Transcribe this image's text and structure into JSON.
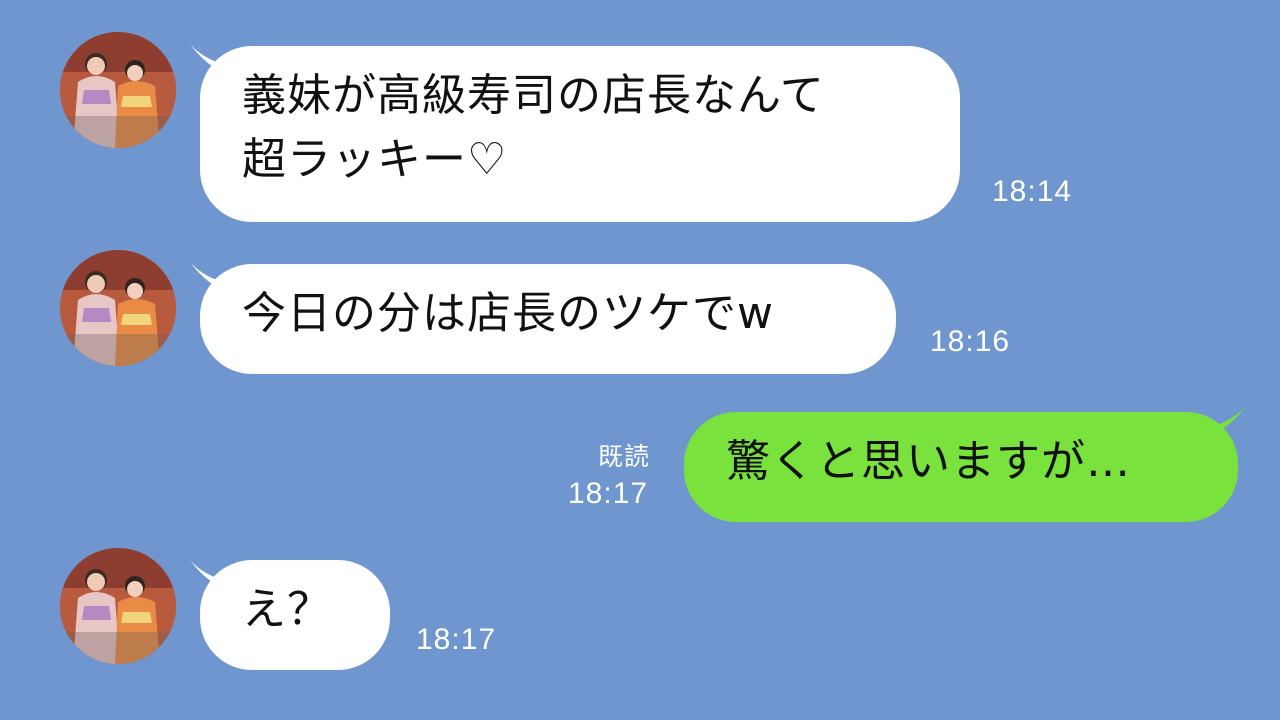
{
  "messages": [
    {
      "id": "m1",
      "direction": "incoming",
      "text": "義妹が高級寿司の店長なんて\n超ラッキー♡",
      "time": "18:14"
    },
    {
      "id": "m2",
      "direction": "incoming",
      "text": "今日の分は店長のツケでw",
      "time": "18:16"
    },
    {
      "id": "m3",
      "direction": "outgoing",
      "text": "驚くと思いますが…",
      "status": "既読",
      "time": "18:17"
    },
    {
      "id": "m4",
      "direction": "incoming",
      "text": "え？",
      "time": "18:17"
    }
  ],
  "colors": {
    "background": "#7096cf",
    "incoming_bubble": "#ffffff",
    "outgoing_bubble": "#79e23c",
    "meta_text": "#ffffff"
  },
  "icons": {
    "avatar": "contact-avatar-icon"
  }
}
